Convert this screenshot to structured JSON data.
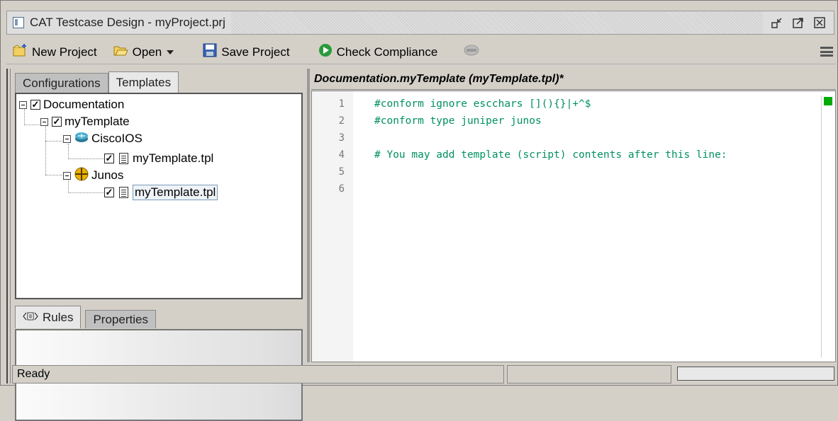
{
  "window": {
    "title": "CAT Testcase Design - myProject.prj"
  },
  "toolbar": {
    "new_project": "New Project",
    "open": "Open",
    "save_project": "Save Project",
    "check_compliance": "Check Compliance"
  },
  "left_tabs": {
    "configurations": "Configurations",
    "templates": "Templates"
  },
  "tree": {
    "root": "Documentation",
    "template": "myTemplate",
    "cisco": "CiscoIOS",
    "cisco_file": "myTemplate.tpl",
    "junos": "Junos",
    "junos_file": "myTemplate.tpl",
    "check_mark": "✓"
  },
  "bottom_tabs": {
    "rules": "Rules",
    "properties": "Properties"
  },
  "editor": {
    "title": "Documentation.myTemplate (myTemplate.tpl)*",
    "line_numbers": [
      "1",
      "2",
      "3",
      "4",
      "5",
      "6"
    ],
    "lines": [
      "#conform ignore escchars [](){}|+^$",
      "#conform type juniper junos",
      "",
      "# You may add template (script) contents after this line:",
      "",
      ""
    ]
  },
  "status": {
    "text": "Ready"
  },
  "colors": {
    "code": "#009060",
    "marker": "#00aa00"
  }
}
